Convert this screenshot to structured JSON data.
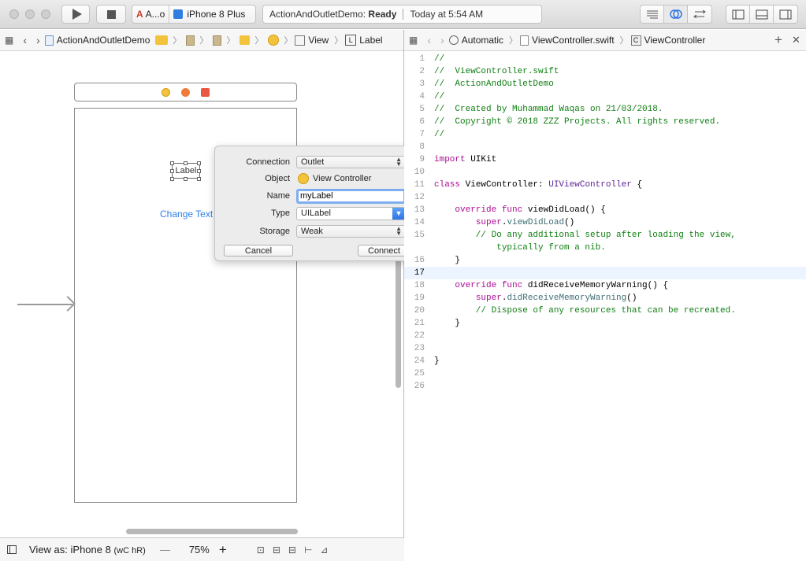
{
  "toolbar": {
    "scheme_target": "A...o",
    "scheme_device": "iPhone 8 Plus",
    "status_project": "ActionAndOutletDemo:",
    "status_state": "Ready",
    "status_time": "Today at 5:54 AM"
  },
  "jumpbar_left": {
    "project": "ActionAndOutletDemo",
    "view": "View",
    "label": "Label"
  },
  "jumpbar_right": {
    "automatic": "Automatic",
    "file": "ViewController.swift",
    "class": "ViewController"
  },
  "canvas": {
    "label_text": "Label",
    "button_text": "Change Text"
  },
  "popover": {
    "connection_label": "Connection",
    "connection_value": "Outlet",
    "object_label": "Object",
    "object_value": "View Controller",
    "name_label": "Name",
    "name_value": "myLabel",
    "type_label": "Type",
    "type_value": "UILabel",
    "storage_label": "Storage",
    "storage_value": "Weak",
    "cancel": "Cancel",
    "connect": "Connect"
  },
  "code": {
    "current_line": "17",
    "lines": [
      {
        "n": "1",
        "parts": [
          {
            "c": "t-com",
            "t": "//"
          }
        ]
      },
      {
        "n": "2",
        "parts": [
          {
            "c": "t-com",
            "t": "//  ViewController.swift"
          }
        ]
      },
      {
        "n": "3",
        "parts": [
          {
            "c": "t-com",
            "t": "//  ActionAndOutletDemo"
          }
        ]
      },
      {
        "n": "4",
        "parts": [
          {
            "c": "t-com",
            "t": "//"
          }
        ]
      },
      {
        "n": "5",
        "parts": [
          {
            "c": "t-com",
            "t": "//  Created by Muhammad Waqas on 21/03/2018."
          }
        ]
      },
      {
        "n": "6",
        "parts": [
          {
            "c": "t-com",
            "t": "//  Copyright © 2018 ZZZ Projects. All rights reserved."
          }
        ]
      },
      {
        "n": "7",
        "parts": [
          {
            "c": "t-com",
            "t": "//"
          }
        ]
      },
      {
        "n": "8",
        "parts": []
      },
      {
        "n": "9",
        "parts": [
          {
            "c": "t-kw",
            "t": "import"
          },
          {
            "c": "t-pl",
            "t": " UIKit"
          }
        ]
      },
      {
        "n": "10",
        "parts": []
      },
      {
        "n": "11",
        "parts": [
          {
            "c": "t-kw",
            "t": "class"
          },
          {
            "c": "t-pl",
            "t": " ViewController: "
          },
          {
            "c": "t-type",
            "t": "UIViewController"
          },
          {
            "c": "t-pl",
            "t": " {"
          }
        ]
      },
      {
        "n": "12",
        "parts": []
      },
      {
        "n": "13",
        "parts": [
          {
            "c": "t-pl",
            "t": "    "
          },
          {
            "c": "t-kw",
            "t": "override func"
          },
          {
            "c": "t-pl",
            "t": " viewDidLoad() {"
          }
        ]
      },
      {
        "n": "14",
        "parts": [
          {
            "c": "t-pl",
            "t": "        "
          },
          {
            "c": "t-kw",
            "t": "super"
          },
          {
            "c": "t-pl",
            "t": "."
          },
          {
            "c": "t-fn",
            "t": "viewDidLoad"
          },
          {
            "c": "t-pl",
            "t": "()"
          }
        ]
      },
      {
        "n": "15",
        "parts": [
          {
            "c": "t-com",
            "t": "        // Do any additional setup after loading the view,"
          }
        ]
      },
      {
        "n": "",
        "parts": [
          {
            "c": "t-com",
            "t": "            typically from a nib."
          }
        ]
      },
      {
        "n": "16",
        "parts": [
          {
            "c": "t-pl",
            "t": "    }"
          }
        ]
      },
      {
        "n": "17",
        "parts": []
      },
      {
        "n": "18",
        "parts": [
          {
            "c": "t-pl",
            "t": "    "
          },
          {
            "c": "t-kw",
            "t": "override func"
          },
          {
            "c": "t-pl",
            "t": " didReceiveMemoryWarning() {"
          }
        ]
      },
      {
        "n": "19",
        "parts": [
          {
            "c": "t-pl",
            "t": "        "
          },
          {
            "c": "t-kw",
            "t": "super"
          },
          {
            "c": "t-pl",
            "t": "."
          },
          {
            "c": "t-fn",
            "t": "didReceiveMemoryWarning"
          },
          {
            "c": "t-pl",
            "t": "()"
          }
        ]
      },
      {
        "n": "20",
        "parts": [
          {
            "c": "t-com",
            "t": "        // Dispose of any resources that can be recreated."
          }
        ]
      },
      {
        "n": "21",
        "parts": [
          {
            "c": "t-pl",
            "t": "    }"
          }
        ]
      },
      {
        "n": "22",
        "parts": []
      },
      {
        "n": "23",
        "parts": []
      },
      {
        "n": "24",
        "parts": [
          {
            "c": "t-pl",
            "t": "}"
          }
        ]
      },
      {
        "n": "25",
        "parts": []
      },
      {
        "n": "26",
        "parts": []
      }
    ]
  },
  "bottombar": {
    "view_as": "View as: iPhone 8",
    "size_class": "(wC hR)",
    "minus": "—",
    "zoom": "75%",
    "plus": "+"
  },
  "colors": {
    "comment": "#0f7f12",
    "keyword": "#aa0d91",
    "type": "#5c2699",
    "link_blue": "#2f80ed"
  }
}
